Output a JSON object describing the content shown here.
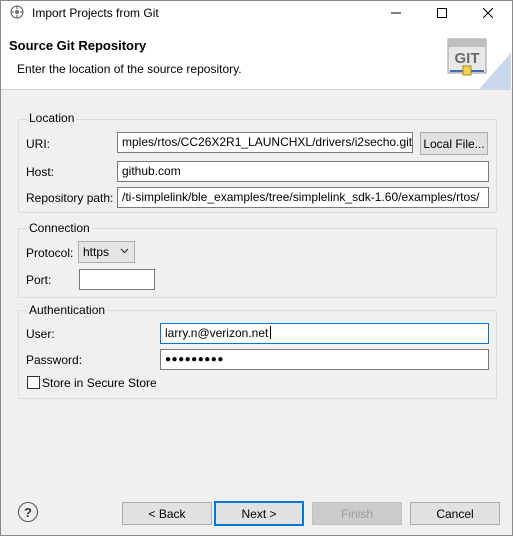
{
  "window": {
    "title": "Import Projects from Git"
  },
  "banner": {
    "title": "Source Git Repository",
    "subtitle": "Enter the location of the source repository.",
    "logo_text": "GIT"
  },
  "location": {
    "group_label": "Location",
    "uri_label": "URI:",
    "uri_value": "mples/rtos/CC26X2R1_LAUNCHXL/drivers/i2secho.git",
    "local_file_label": "Local File...",
    "host_label": "Host:",
    "host_value": "github.com",
    "repo_path_label": "Repository path:",
    "repo_path_value": "/ti-simplelink/ble_examples/tree/simplelink_sdk-1.60/examples/rtos/"
  },
  "connection": {
    "group_label": "Connection",
    "protocol_label": "Protocol:",
    "protocol_value": "https",
    "port_label": "Port:",
    "port_value": ""
  },
  "authentication": {
    "group_label": "Authentication",
    "user_label": "User:",
    "user_value": "larry.n@verizon.net",
    "password_label": "Password:",
    "password_value": "●●●●●●●●●",
    "store_label": "Store in Secure Store",
    "store_checked": false
  },
  "footer": {
    "help_glyph": "?",
    "back_label": "< Back",
    "next_label": "Next >",
    "finish_label": "Finish",
    "cancel_label": "Cancel"
  },
  "colors": {
    "accent": "#0078d7",
    "background": "#f0f0f0",
    "banner": "#ffffff"
  }
}
